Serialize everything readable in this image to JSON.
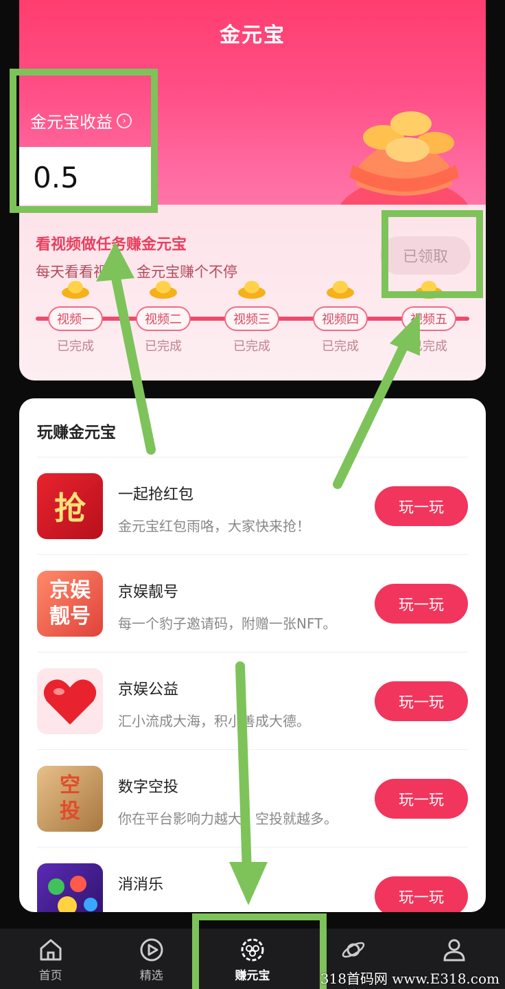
{
  "header": {
    "title": "金元宝",
    "earnings_label": "金元宝收益",
    "earnings_value": "0.5"
  },
  "task": {
    "title": "看视频做任务赚金元宝",
    "subtitle": "每天看看视频，金元宝赚个不停",
    "claim_label": "已领取",
    "steps": [
      {
        "label": "视频一",
        "status": "已完成"
      },
      {
        "label": "视频二",
        "status": "已完成"
      },
      {
        "label": "视频三",
        "status": "已完成"
      },
      {
        "label": "视频四",
        "status": "已完成"
      },
      {
        "label": "视频五",
        "status": "已完成"
      }
    ]
  },
  "games": {
    "title": "玩赚金元宝",
    "items": [
      {
        "name": "一起抢红包",
        "desc": "金元宝红包雨咯，大家快来抢！",
        "button": "玩一玩",
        "icon_text": "抢"
      },
      {
        "name": "京娱靓号",
        "desc": "每一个豹子邀请码，附赠一张NFT。",
        "button": "玩一玩",
        "icon_text": "京娱靓号"
      },
      {
        "name": "京娱公益",
        "desc": "汇小流成大海，积小善成大德。",
        "button": "玩一玩",
        "icon_text": ""
      },
      {
        "name": "数字空投",
        "desc": "你在平台影响力越大，空投就越多。",
        "button": "玩一玩",
        "icon_text": "空投"
      },
      {
        "name": "消消乐",
        "desc": "",
        "button": "玩一玩",
        "icon_text": ""
      }
    ]
  },
  "nav": {
    "items": [
      {
        "label": "首页",
        "icon": "home-icon"
      },
      {
        "label": "精选",
        "icon": "play-circle-icon"
      },
      {
        "label": "赚元宝",
        "icon": "earn-ingot-icon"
      },
      {
        "label": "",
        "icon": "planet-icon"
      },
      {
        "label": "",
        "icon": "profile-icon"
      }
    ],
    "active_index": 2
  },
  "watermark": "318首码网 www.E318.com",
  "colors": {
    "accent": "#f2355c",
    "annotation": "#7dc35a",
    "header_top": "#ff3d6f"
  }
}
